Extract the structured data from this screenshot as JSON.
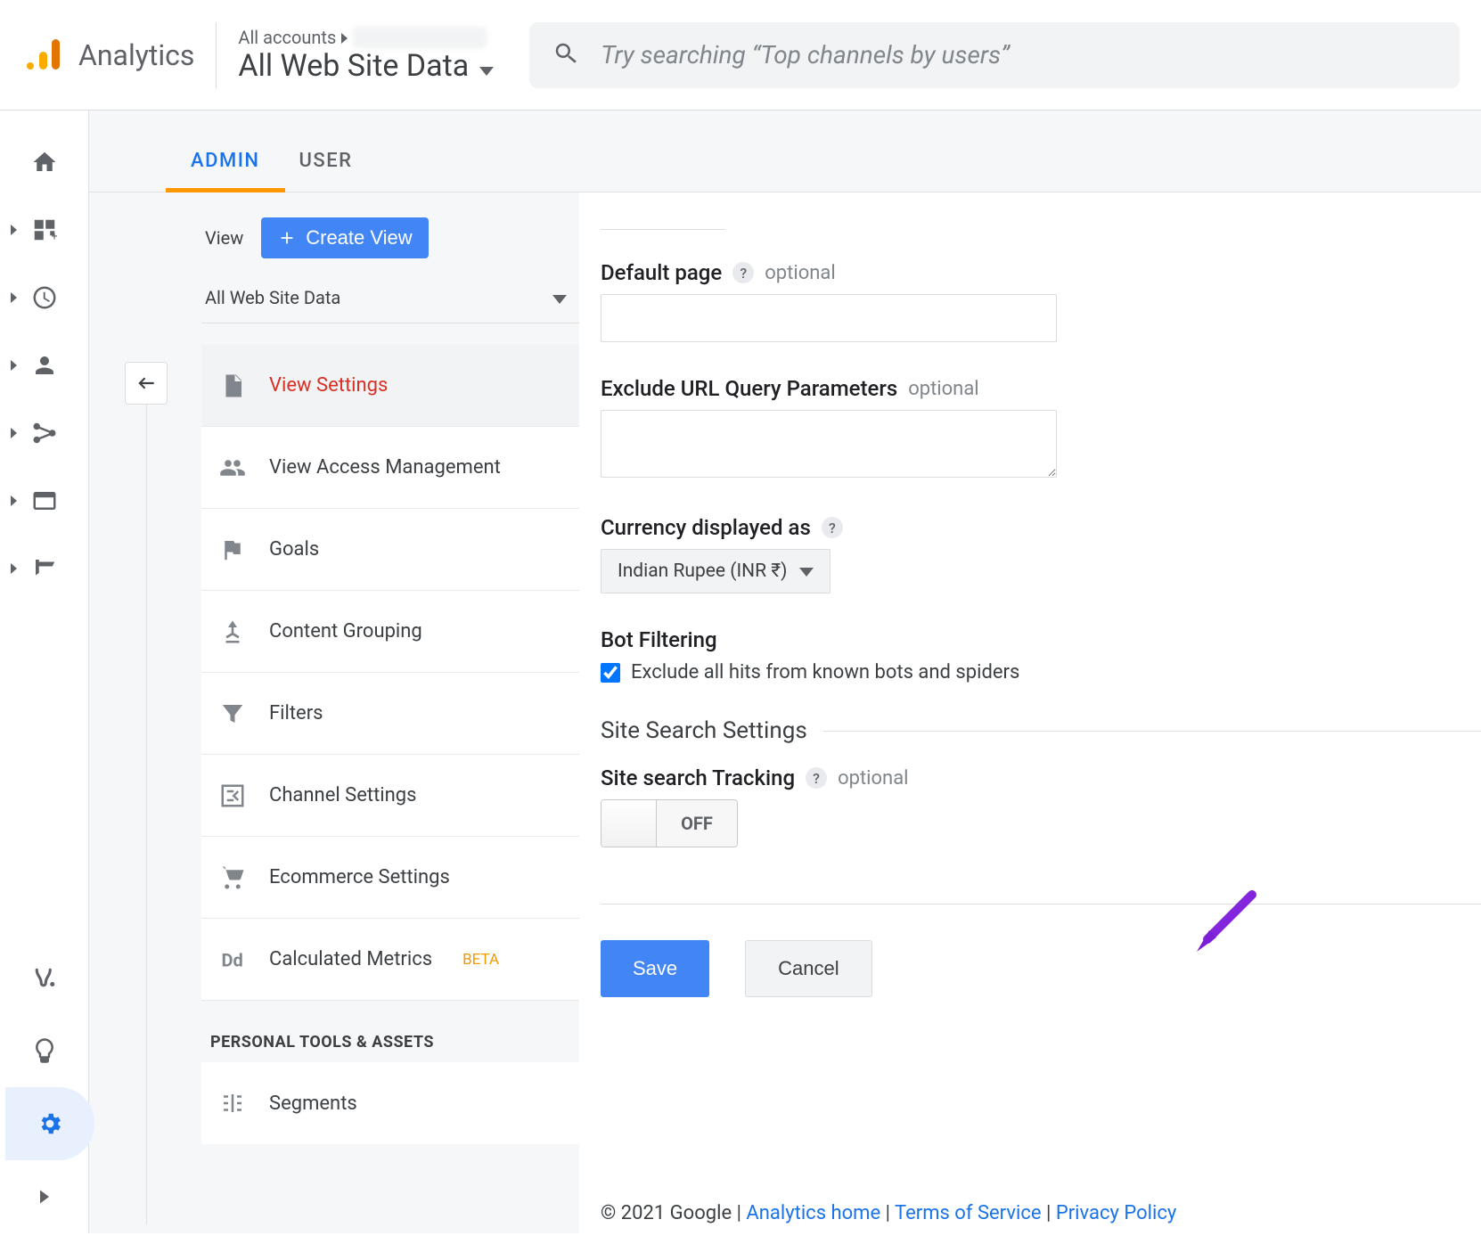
{
  "header": {
    "product_name": "Analytics",
    "breadcrumb_root": "All accounts",
    "property_name": "All Web Site Data",
    "search_placeholder": "Try searching “Top channels by users”"
  },
  "tabs": {
    "admin": "ADMIN",
    "user": "USER",
    "active": "admin"
  },
  "view_panel": {
    "label": "View",
    "create_label": "Create View",
    "selected_view": "All Web Site Data",
    "menu": [
      {
        "id": "view-settings",
        "label": "View Settings",
        "active": true
      },
      {
        "id": "view-access",
        "label": "View Access Management"
      },
      {
        "id": "goals",
        "label": "Goals"
      },
      {
        "id": "content-grouping",
        "label": "Content Grouping"
      },
      {
        "id": "filters",
        "label": "Filters"
      },
      {
        "id": "channel-settings",
        "label": "Channel Settings"
      },
      {
        "id": "ecommerce-settings",
        "label": "Ecommerce Settings"
      },
      {
        "id": "calculated-metrics",
        "label": "Calculated Metrics",
        "beta": "BETA"
      }
    ],
    "section_caption": "PERSONAL TOOLS & ASSETS",
    "personal_items": [
      {
        "id": "segments",
        "label": "Segments"
      }
    ]
  },
  "form": {
    "default_page": {
      "label": "Default page",
      "optional": "optional",
      "value": ""
    },
    "exclude_params": {
      "label": "Exclude URL Query Parameters",
      "optional": "optional",
      "value": ""
    },
    "currency": {
      "label": "Currency displayed as",
      "value": "Indian Rupee (INR ₹)"
    },
    "bot_filtering": {
      "label": "Bot Filtering",
      "checkbox_text": "Exclude all hits from known bots and spiders",
      "checked": true
    },
    "site_search_section": "Site Search Settings",
    "site_search_tracking": {
      "label": "Site search Tracking",
      "optional": "optional",
      "state": "OFF"
    },
    "save": "Save",
    "cancel": "Cancel"
  },
  "footer": {
    "copyright": "© 2021 Google",
    "analytics_home": "Analytics home",
    "terms": "Terms of Service",
    "privacy": "Privacy Policy"
  }
}
